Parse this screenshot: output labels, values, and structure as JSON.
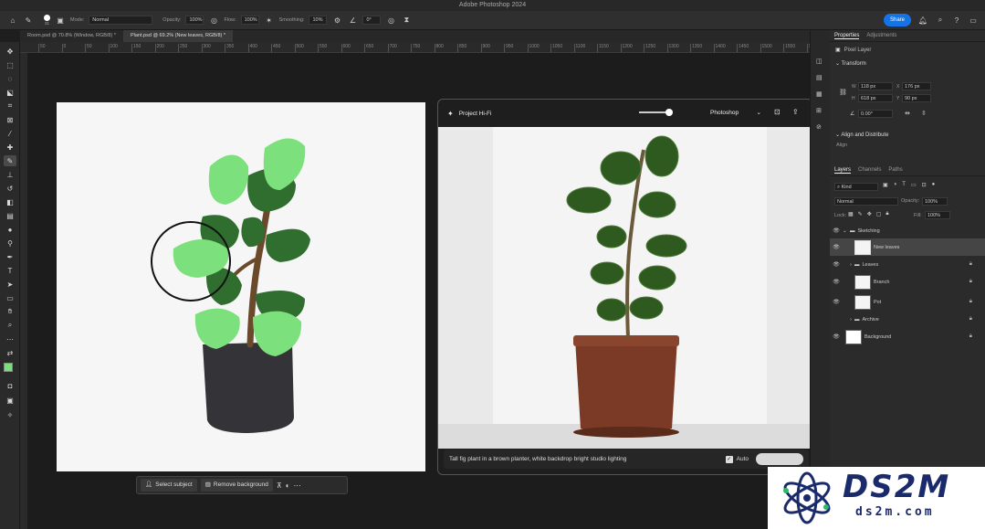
{
  "window": {
    "title": "Adobe Photoshop 2024"
  },
  "options_bar": {
    "brush_size": "31",
    "mode_label": "Mode:",
    "mode_value": "Normal",
    "opacity_label": "Opacity:",
    "opacity_value": "100%",
    "flow_label": "Flow:",
    "flow_value": "100%",
    "smoothing_label": "Smoothing:",
    "smoothing_value": "10%",
    "angle_value": "0°",
    "share_label": "Share"
  },
  "tabs": [
    {
      "label": "Room.psd @ 70.8% (Window, RGB/8) *"
    },
    {
      "label": "Plant.psd @ 69.2% (New leaves, RGB/8) *"
    }
  ],
  "ruler_ticks": [
    "50",
    "0",
    "50",
    "100",
    "150",
    "200",
    "250",
    "300",
    "350",
    "400",
    "450",
    "500",
    "550",
    "600",
    "650",
    "700",
    "750",
    "800",
    "850",
    "900",
    "950",
    "1000",
    "1050",
    "1100",
    "1150",
    "1200",
    "1250",
    "1300",
    "1350",
    "1400",
    "1450",
    "1500",
    "1550",
    "1600"
  ],
  "context_bar": {
    "select_subject": "Select subject",
    "remove_background": "Remove background"
  },
  "hifi": {
    "title": "Project Hi-Fi",
    "app_select": "Photoshop",
    "prompt": "Tall fig plant in a brown planter, white backdrop bright studio lighting",
    "auto_label": "Auto"
  },
  "properties": {
    "tab_properties": "Properties",
    "tab_adjustments": "Adjustments",
    "pixel_layer": "Pixel Layer",
    "transform_label": "Transform",
    "w_label": "W",
    "w_value": "118 px",
    "x_label": "X",
    "x_value": "176 px",
    "h_label": "H",
    "h_value": "618 px",
    "y_label": "Y",
    "y_value": "90 px",
    "angle_value": "0.00°",
    "align_label": "Align and Distribute",
    "align_sub": "Align"
  },
  "layers_panel": {
    "tab_layers": "Layers",
    "tab_channels": "Channels",
    "tab_paths": "Paths",
    "kind_label": "Kind",
    "blend_value": "Normal",
    "opacity_label": "Opacity:",
    "opacity_value": "100%",
    "lock_label": "Lock:",
    "fill_label": "Fill:",
    "fill_value": "100%",
    "layers": [
      {
        "name": "Sketching",
        "type": "group",
        "expanded": true
      },
      {
        "name": "New leaves",
        "type": "layer",
        "selected": true
      },
      {
        "name": "Leaves",
        "type": "group",
        "expanded": false
      },
      {
        "name": "Branch",
        "type": "layer"
      },
      {
        "name": "Pot",
        "type": "layer"
      },
      {
        "name": "Archive",
        "type": "group",
        "expanded": false
      },
      {
        "name": "Background",
        "type": "layer"
      }
    ]
  },
  "watermark": {
    "brand": "DS2M",
    "url": "ds2m.com"
  },
  "colors": {
    "accent": "#1473e6",
    "foreground_swatch": "#7be07b",
    "background_swatch": "#1a1a1a"
  }
}
